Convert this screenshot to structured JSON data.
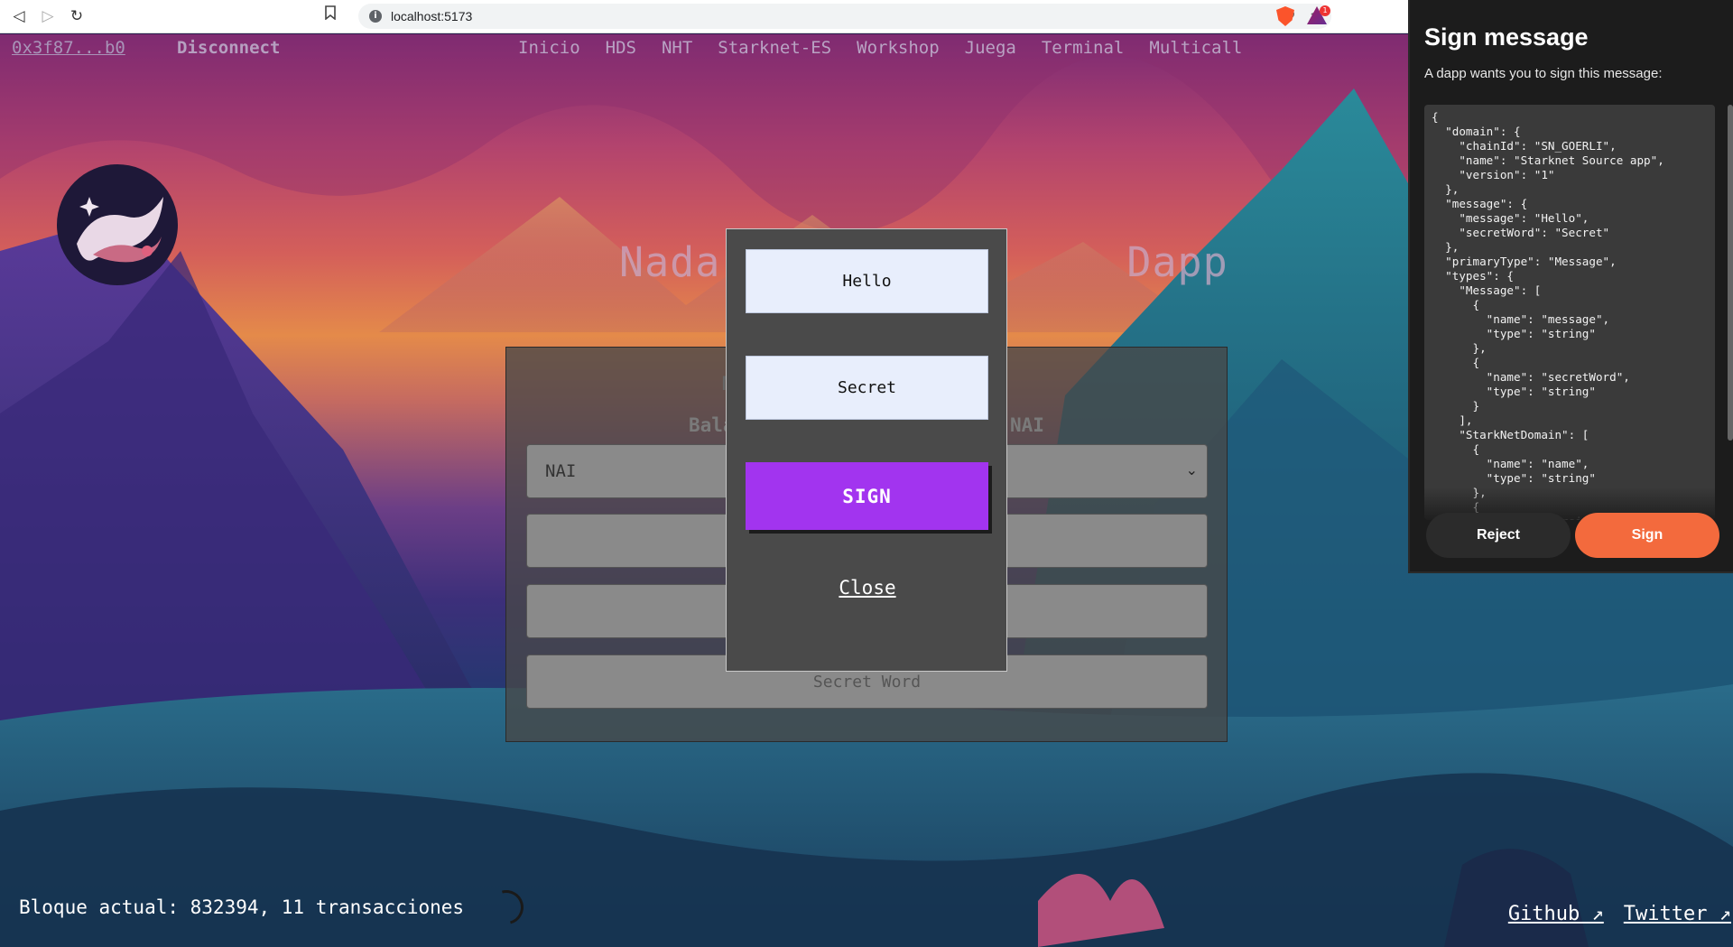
{
  "browser": {
    "url": "localhost:5173",
    "back_icon": "back-icon",
    "forward_icon": "forward-icon",
    "reload_icon": "reload-icon",
    "bookmark_icon": "bookmark-icon",
    "zoom_icon": "zoom-icon",
    "share_icon": "share-icon",
    "ext_badge": "1"
  },
  "nav": {
    "account": "0x3f87...b0",
    "disconnect": "Disconnect",
    "links": [
      "Inicio",
      "HDS",
      "NHT",
      "Starknet-ES",
      "Workshop",
      "Juega",
      "Terminal",
      "Multicall"
    ]
  },
  "hero": {
    "title_left": "Nada",
    "title_right": "Dapp"
  },
  "form": {
    "heading_fragment": "M",
    "balance_left": "Bala",
    "balance_right": "NAI",
    "token_selected": "NAI",
    "secret_word_placeholder": "Secret Word"
  },
  "modal": {
    "message_value": "Hello",
    "secret_value": "Secret",
    "sign_label": "SIGN",
    "close_label": "Close"
  },
  "footer": {
    "block_info": "Bloque actual: 832394, 11 transacciones",
    "github": "Github ↗",
    "twitter": "Twitter ↗"
  },
  "wallet": {
    "title": "Sign message",
    "subtitle": "A dapp wants you to sign this message:",
    "json": "{\n  \"domain\": {\n    \"chainId\": \"SN_GOERLI\",\n    \"name\": \"Starknet Source app\",\n    \"version\": \"1\"\n  },\n  \"message\": {\n    \"message\": \"Hello\",\n    \"secretWord\": \"Secret\"\n  },\n  \"primaryType\": \"Message\",\n  \"types\": {\n    \"Message\": [\n      {\n        \"name\": \"message\",\n        \"type\": \"string\"\n      },\n      {\n        \"name\": \"secretWord\",\n        \"type\": \"string\"\n      }\n    ],\n    \"StarkNetDomain\": [\n      {\n        \"name\": \"name\",\n        \"type\": \"string\"\n      },\n      {\n        \"name\": \"version\",",
    "reject_label": "Reject",
    "sign_label": "Sign"
  },
  "colors": {
    "sign_purple": "#a234ef",
    "wallet_sign_orange": "#f36a3d",
    "wallet_bg": "#1c1c1c"
  }
}
